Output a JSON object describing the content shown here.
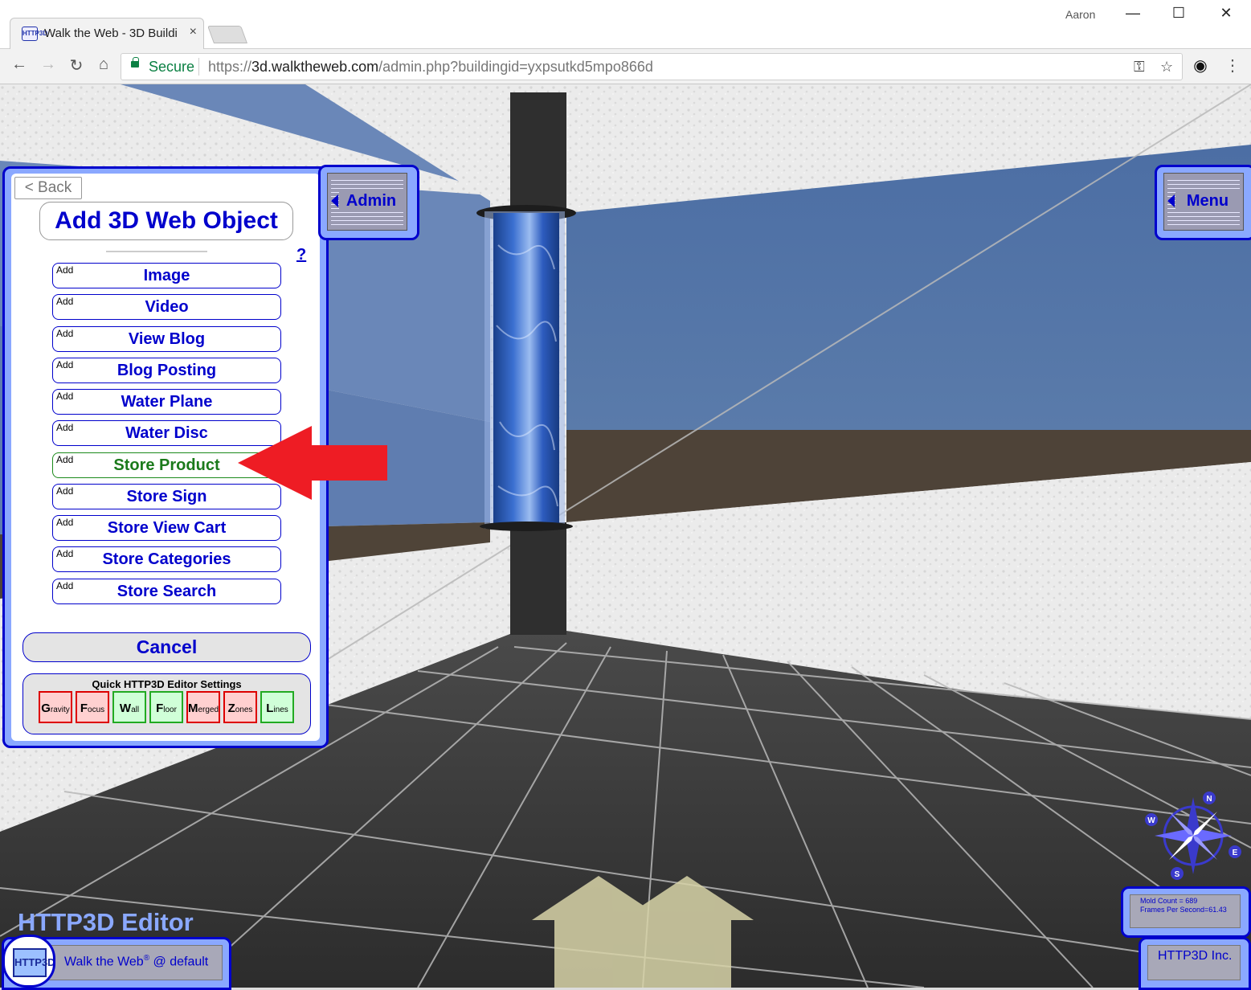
{
  "browser": {
    "tab_title": "Walk the Web - 3D Buildi",
    "favicon_text": "HTTP3D",
    "tab_close": "×",
    "user": "Aaron",
    "window_minimize": "—",
    "window_maximize": "☐",
    "window_close": "✕",
    "back": "←",
    "forward": "→",
    "reload": "↻",
    "home": "⌂",
    "secure_label": "Secure",
    "url_scheme": "https://",
    "url_host": "3d.walktheweb.com",
    "url_path": "/admin.php?buildingid=yxpsutkd5mpo866d",
    "key_icon": "⚿",
    "star_icon": "☆",
    "extension_icon": "◉",
    "menu_icon": "⋮"
  },
  "panel": {
    "back_label": "< Back",
    "title": "Add 3D Web Object",
    "help_label": "?",
    "add_prefix": "Add",
    "items": [
      {
        "label": "Image"
      },
      {
        "label": "Video"
      },
      {
        "label": "View Blog"
      },
      {
        "label": "Blog Posting"
      },
      {
        "label": "Water Plane"
      },
      {
        "label": "Water Disc"
      },
      {
        "label": "Store Product"
      },
      {
        "label": "Store Sign"
      },
      {
        "label": "Store View Cart"
      },
      {
        "label": "Store Categories"
      },
      {
        "label": "Store Search"
      }
    ],
    "highlighted_item": "Store Product",
    "cancel_label": "Cancel",
    "quick_settings_title": "Quick HTTP3D Editor Settings",
    "toggles": [
      {
        "initial": "G",
        "rest": "ravity",
        "state": "off"
      },
      {
        "initial": "F",
        "rest": "ocus",
        "state": "off"
      },
      {
        "initial": "W",
        "rest": "all",
        "state": "on"
      },
      {
        "initial": "F",
        "rest": "loor",
        "state": "on"
      },
      {
        "initial": "M",
        "rest": "erged",
        "state": "off"
      },
      {
        "initial": "Z",
        "rest": "ones",
        "state": "off"
      },
      {
        "initial": "L",
        "rest": "ines",
        "state": "on"
      }
    ]
  },
  "nav": {
    "admin_label": "Admin",
    "menu_label": "Menu"
  },
  "footer": {
    "editor_title": "HTTP3D Editor",
    "logo_text": "HTTP3D",
    "site_label": "Walk the Web",
    "site_reg": "®",
    "site_suffix": " @ default",
    "mold_count": "Mold Count = 689",
    "fps": "Frames Per Second=61.43",
    "company": "HTTP3D Inc."
  },
  "compass": {
    "n": "N",
    "e": "E",
    "s": "S",
    "w": "W"
  },
  "colors": {
    "accent_blue": "#0000cc",
    "panel_blue": "#8aa8ff",
    "highlight_green": "#1b7a1b",
    "annotation_red": "#ee1c24"
  }
}
